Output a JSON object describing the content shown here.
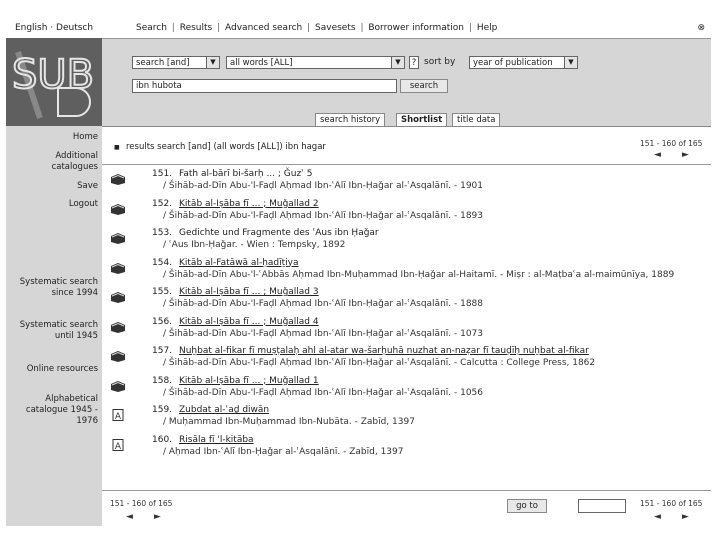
{
  "sidebar": {
    "lang": "English · Deutsch",
    "logo_text": "SUB",
    "nav": {
      "home": "Home",
      "additional": "Additional catalogues",
      "save": "Save",
      "logout": "Logout",
      "sys1994": "Systematic search since 1994",
      "sys1945": "Systematic search until 1945",
      "online": "Online resources",
      "alpha": "Alphabetical catalogue 1945 - 1976"
    }
  },
  "topnav": {
    "search": "Search",
    "results": "Results",
    "advanced": "Advanced search",
    "savesets": "Savesets",
    "borrower": "Borrower information",
    "help": "Help",
    "sep": "|",
    "close": "⊗"
  },
  "search": {
    "field_select": "search [and]",
    "words_select": "all words [ALL]",
    "info": "?",
    "sort_label": "sort by",
    "sort_select": "year of publication",
    "query": "ibn hubota",
    "button": "search"
  },
  "tabs": {
    "history": "search history",
    "shortlist": "Shortlist",
    "titledata": "title data"
  },
  "results": {
    "bullet": "■",
    "header": "results search [and] (all words [ALL]) ibn hagar",
    "range_top": "151 - 160 of 165",
    "range_bottom": "151 - 160 of 165",
    "prev": "◄",
    "next": "►",
    "goto": "go to",
    "items": [
      {
        "num": "151.",
        "title": "Fath al-bārī bi-šarḥ ... ; Ǧuzʾ 5",
        "link": false,
        "icon": "book",
        "sub": "/ Šihāb-ad-Dīn Abu-'l-Faḍl Aḥmad Ibn-ʿAlī Ibn-Ḥaǧar al-ʿAsqalānī. - 1901"
      },
      {
        "num": "152.",
        "title": "Kitāb al-Iṣāba fī ... ; Muǧallad 2",
        "link": true,
        "icon": "book",
        "sub": "/ Šihāb-ad-Dīn Abu-'l-Faḍl Aḥmad Ibn-ʿAlī Ibn-Ḥaǧar al-ʿAsqalānī. - 1893"
      },
      {
        "num": "153.",
        "title": "Gedichte und Fragmente des ʿAus ibn Ḥaǧar",
        "link": false,
        "icon": "book",
        "sub": "/ ʿAus Ibn-Ḥaǧar. - Wien : Tempsky, 1892"
      },
      {
        "num": "154.",
        "title": "Kitāb al-Fatāwā al-ḥadīṯiya",
        "link": true,
        "icon": "book",
        "sub": "/ Šihāb-ad-Dīn Abu-'l-ʿAbbās Aḥmad Ibn-Muḥammad Ibn-Ḥaǧar al-Haitamī. - Miṣr : al-Maṭbaʿa al-maimūnīya, 1889"
      },
      {
        "num": "155.",
        "title": "Kitāb al-Iṣāba fī ... ; Muǧallad 3",
        "link": true,
        "icon": "book",
        "sub": "/ Šihāb-ad-Dīn Abu-'l-Faḍl Aḥmad Ibn-ʿAlī Ibn-Ḥaǧar al-ʿAsqalānī. - 1888"
      },
      {
        "num": "156.",
        "title": "Kitāb al-Iṣāba fī ... ; Muǧallad 4",
        "link": true,
        "icon": "book",
        "sub": "/ Šihāb-ad-Dīn Abu-'l-Faḍl Aḥmad Ibn-ʿAlī Ibn-Ḥaǧar al-ʿAsqalānī. - 1073"
      },
      {
        "num": "157.",
        "title": "Nuḫbat al-fikar fī muṣṭalaḥ ahl al-aṯar wa-šarḥuhā nuzhat an-naẓar fī tauḍīḥ nuḫbat al-fikar",
        "link": true,
        "icon": "book",
        "sub": "/ Šihāb-ad-Dīn Abu-'l-Faḍl Aḥmad Ibn-ʿAlī Ibn-Ḥaǧar al-ʿAsqalānī. - Calcutta : College Press, 1862"
      },
      {
        "num": "158.",
        "title": "Kitāb al-Iṣāba fī ... ; Muǧallad 1",
        "link": true,
        "icon": "book",
        "sub": "/ Šihāb-ad-Dīn Abu-'l-Faḍl Aḥmad Ibn-ʿAlī Ibn-Ḥaǧar al-ʿAsqalānī. - 1056"
      },
      {
        "num": "159.",
        "title": "Zubdat al-ʿaḏ diwān",
        "link": true,
        "icon": "doc",
        "sub": "/ Muḥammad Ibn-Muḥammad Ibn-Nubāta. - Zabīd, 1397"
      },
      {
        "num": "160.",
        "title": "Risāla fī 'l-kitāba",
        "link": true,
        "icon": "doc",
        "sub": "/ Aḥmad Ibn-ʿAlī Ibn-Ḥaǧar al-ʿAsqalānī. - Zabīd, 1397"
      }
    ]
  }
}
